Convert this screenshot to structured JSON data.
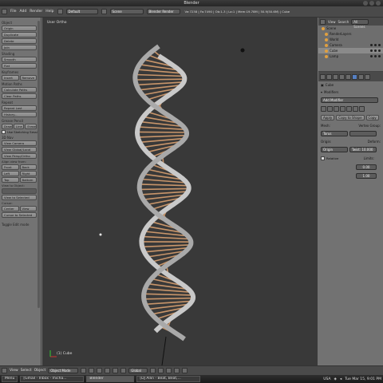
{
  "window": {
    "title": "Blender"
  },
  "header": {
    "menus": [
      "File",
      "Add",
      "Render",
      "Help"
    ],
    "layout": "Default",
    "scene": "Scene",
    "engine": "Blender Render",
    "stats": "Ve:7238 | Fa:7490 | Ob:1-3 | La:1 | Mem:19.78M | 50.9(50.6M) | Cube"
  },
  "toolshelf": {
    "object_section": "Object",
    "object_btns": [
      "Origin",
      "Duplicate",
      "Delete",
      "Join"
    ],
    "shading_section": "Shading",
    "shading_btns": [
      "Smooth",
      "Flat"
    ],
    "keyframes_section": "Keyframes",
    "keyframes_btns": [
      "Insert",
      "Remove"
    ],
    "motion_section": "Motion Paths",
    "motion_btns": [
      "Calculate Paths",
      "Clear Paths"
    ],
    "repeat_section": "Repeat",
    "repeat_btns": [
      "Repeat Last",
      "History..."
    ],
    "grease_section": "Grease Pencil",
    "grease_btns": [
      "Draw",
      "Line",
      "Erase"
    ],
    "grease_check": "Use Sketching Sessi",
    "view3d_section": "3D Nav",
    "view3d_btns": [
      "View Camera",
      "View Global/Local",
      "View Persp/Ortho"
    ],
    "align_label": "Align view from:",
    "align_rows": [
      [
        "Front",
        "Back"
      ],
      [
        "Left",
        "Right"
      ],
      [
        "Top",
        "Bottom"
      ]
    ],
    "viewobj_label": "View to Object:",
    "view_selected": "View to Selected",
    "cursor_label": "Cursor:",
    "cursor_btns": [
      "Center",
      "View"
    ],
    "cursor_selected": "Cursor to Selected",
    "toggle_edit": "Toggle Edit mode"
  },
  "viewport": {
    "label": "User Ortho",
    "object": "(1) Cube"
  },
  "outliner": {
    "view_menu": "View",
    "search_menu": "Search",
    "filter": "All Scenes",
    "items": [
      "Scene",
      "RenderLayers",
      "World",
      "Camera",
      "Cube",
      "Lamp"
    ]
  },
  "properties": {
    "object": "Cube",
    "section": "Modifiers",
    "add_modifier": "Add Modifier",
    "mod_btns": [
      "Apply",
      "Copy to Shape",
      "Copy"
    ],
    "mesh_label": "Mesh:",
    "mesh_value": "Torus",
    "vgroup_label": "Vertex Group:",
    "origin_label": "Origin:",
    "origin_value": "Origin",
    "deform_label": "Deform:",
    "deform_value": "Twist: 10.000",
    "relative_label": "Relative",
    "limits_label": "Limits:",
    "limit1": "0.00",
    "limit2": "1.00"
  },
  "footer": {
    "view": "View",
    "select": "Select",
    "object": "Object",
    "mode": "Object Mode",
    "global": "Global"
  },
  "taskbar": {
    "menu": "Menu",
    "tasks": [
      "[Gmail - Inbox - micha...",
      "Blender",
      "[DJ Allin - Beat, Beat,..."
    ],
    "lang": "USA",
    "clock": "Tue Mar 15, 9:01 PM"
  }
}
